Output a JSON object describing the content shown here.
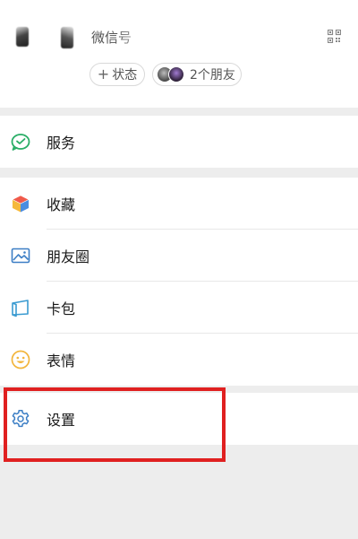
{
  "profile": {
    "wechat_id_label": "微信号",
    "status_button": "状态",
    "status_plus": "+",
    "friends_label": "2个朋友"
  },
  "menu": {
    "service": "服务",
    "favorites": "收藏",
    "moments": "朋友圈",
    "cards": "卡包",
    "stickers": "表情",
    "settings": "设置"
  },
  "icons": {
    "service": "service-icon",
    "favorites": "favorites-cube-icon",
    "moments": "moments-picture-icon",
    "cards": "card-wallet-icon",
    "stickers": "smiley-icon",
    "settings": "gear-icon",
    "qr": "qr-code-icon"
  },
  "colors": {
    "service_green": "#2aae67",
    "settings_blue": "#3d7fc5",
    "highlight_red": "#e02020",
    "sticker_yellow": "#f2b53c"
  }
}
